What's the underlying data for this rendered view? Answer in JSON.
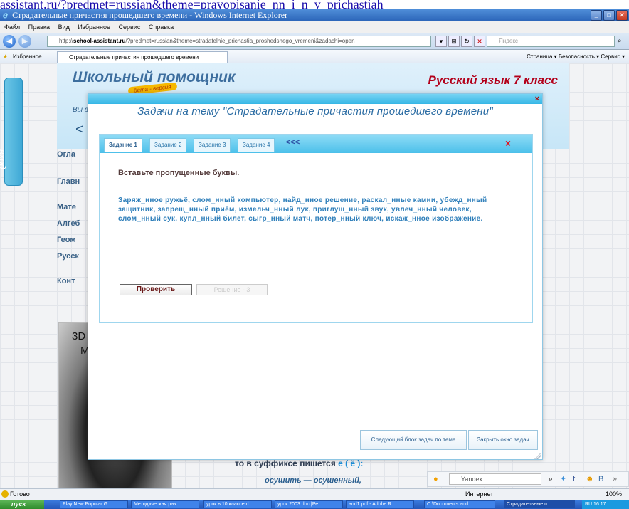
{
  "top_link": "assistant.ru/?predmet=russian&theme=pravopisanie_nn_i_n_v_prichastiah",
  "window": {
    "title": "Страдательные причастия прошедшего времени - Windows Internet Explorer"
  },
  "menu": [
    "Файл",
    "Правка",
    "Вид",
    "Избранное",
    "Сервис",
    "Справка"
  ],
  "address": {
    "url_prefix": "http://",
    "url_host": "school-assistant.ru",
    "url_rest": "/?predmet=russian&theme=stradatelnie_prichastia_proshedshego_vremeni&zadachi=open",
    "search_placeholder": "Яндекс"
  },
  "favorites": {
    "label": "Избранное",
    "tab_title": "Страдательные причастия прошедшего времени",
    "commands": "Страница ▾   Безопасность ▾   Сервис ▾"
  },
  "site": {
    "title": "Школьный помощник",
    "beta": "бета - версия",
    "subject": "Русский язык 7 класс",
    "side_tab": "вход",
    "small": "Вы в",
    "back": "<",
    "menu": [
      "Огла",
      "Главн",
      "Мате",
      "Алгеб",
      "Геом",
      "Русск",
      "Конт"
    ],
    "image_lines": [
      "3D",
      "M"
    ],
    "bottom_line_1": "то в суффиксе пишется",
    "bottom_letter": "е ( ё ):",
    "bottom_example": "осушить  —  осушенный,"
  },
  "modal": {
    "close": "×",
    "title": "Задачи на тему \"Страдательные причастия прошедшего времени\"",
    "tabs": [
      "Задание 1",
      "Задание 2",
      "Задание 3",
      "Задание 4"
    ],
    "tabs_back": "<<<",
    "tabs_close": "×",
    "heading": "Вставьте пропущенные буквы.",
    "text": "Заряж_нное ружьё, слом_нный компьютер, найд_нное решение, раскал_нные камни, убежд_нный защитник, запрещ_нный приём, измельч_нный лук, приглуш_нный звук, увлеч_нный человек, слом_нный сук, купл_нный билет, сыгр_нный матч, потер_нный ключ, искаж_нное изображение.",
    "check_label": "Проверить",
    "solution_label": "Решение - 3",
    "next_block": "Следующий блок задач по теме",
    "close_window": "Закрыть окно задач"
  },
  "yandex": {
    "input": "Yandex"
  },
  "status": {
    "ready": "Готово",
    "zone": "Интернет",
    "zoom": "100%"
  },
  "taskbar": {
    "start": "пуск",
    "items": [
      "Play New Popular G...",
      "Методическая раз...",
      "урок в 10 классе.d...",
      "урок 2003.doc [Ре...",
      "and1.pdf - Adobe R...",
      "C:\\Documents and ...",
      "Страдательные п..."
    ],
    "tray": "RU  16:17"
  },
  "colors": {
    "accent": "#35b6e6",
    "title": "#2b6ca3",
    "task_text": "#2f7fba",
    "close_red": "#e0131f"
  }
}
